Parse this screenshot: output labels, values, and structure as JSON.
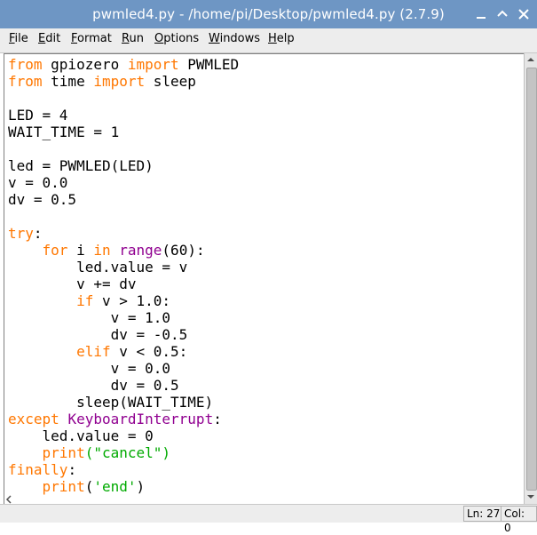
{
  "window": {
    "title": "pwmled4.py - /home/pi/Desktop/pwmled4.py (2.7.9)"
  },
  "menubar": {
    "items": [
      {
        "id": "file",
        "mnemonic": "F",
        "rest": "ile"
      },
      {
        "id": "edit",
        "mnemonic": "E",
        "rest": "dit"
      },
      {
        "id": "format",
        "mnemonic": "F",
        "rest": "ormat"
      },
      {
        "id": "run",
        "mnemonic": "R",
        "rest": "un"
      },
      {
        "id": "options",
        "mnemonic": "O",
        "rest": "ptions"
      },
      {
        "id": "windows",
        "mnemonic": "W",
        "rest": "indows"
      },
      {
        "id": "help",
        "mnemonic": "H",
        "rest": "elp"
      }
    ]
  },
  "editor": {
    "lines": [
      [
        {
          "t": "kw",
          "s": "from"
        },
        {
          "t": "",
          "s": " gpiozero "
        },
        {
          "t": "kw",
          "s": "import"
        },
        {
          "t": "",
          "s": " PWMLED"
        }
      ],
      [
        {
          "t": "kw",
          "s": "from"
        },
        {
          "t": "",
          "s": " time "
        },
        {
          "t": "kw",
          "s": "import"
        },
        {
          "t": "",
          "s": " sleep"
        }
      ],
      [],
      [
        {
          "t": "",
          "s": "LED = 4"
        }
      ],
      [
        {
          "t": "",
          "s": "WAIT_TIME = 1"
        }
      ],
      [],
      [
        {
          "t": "",
          "s": "led = PWMLED(LED)"
        }
      ],
      [
        {
          "t": "",
          "s": "v = 0.0"
        }
      ],
      [
        {
          "t": "",
          "s": "dv = 0.5"
        }
      ],
      [],
      [
        {
          "t": "kw",
          "s": "try"
        },
        {
          "t": "",
          "s": ":"
        }
      ],
      [
        {
          "t": "",
          "s": "    "
        },
        {
          "t": "kw",
          "s": "for"
        },
        {
          "t": "",
          "s": " i "
        },
        {
          "t": "kw",
          "s": "in"
        },
        {
          "t": "",
          "s": " "
        },
        {
          "t": "bi",
          "s": "range"
        },
        {
          "t": "",
          "s": "(60):"
        }
      ],
      [
        {
          "t": "",
          "s": "        led.value = v"
        }
      ],
      [
        {
          "t": "",
          "s": "        v += dv"
        }
      ],
      [
        {
          "t": "",
          "s": "        "
        },
        {
          "t": "kw",
          "s": "if"
        },
        {
          "t": "",
          "s": " v > 1.0:"
        }
      ],
      [
        {
          "t": "",
          "s": "            v = 1.0"
        }
      ],
      [
        {
          "t": "",
          "s": "            dv = -0.5"
        }
      ],
      [
        {
          "t": "",
          "s": "        "
        },
        {
          "t": "kw",
          "s": "elif"
        },
        {
          "t": "",
          "s": " v < 0.5:"
        }
      ],
      [
        {
          "t": "",
          "s": "            v = 0.0"
        }
      ],
      [
        {
          "t": "",
          "s": "            dv = 0.5"
        }
      ],
      [
        {
          "t": "",
          "s": "        sleep(WAIT_TIME)"
        }
      ],
      [
        {
          "t": "kw",
          "s": "except"
        },
        {
          "t": "",
          "s": " "
        },
        {
          "t": "bi",
          "s": "KeyboardInterrupt"
        },
        {
          "t": "",
          "s": ":"
        }
      ],
      [
        {
          "t": "",
          "s": "    led.value = 0"
        }
      ],
      [
        {
          "t": "",
          "s": "    "
        },
        {
          "t": "kw",
          "s": "print"
        },
        {
          "t": "str",
          "s": "(\"cancel\")"
        }
      ],
      [
        {
          "t": "kw",
          "s": "finally"
        },
        {
          "t": "",
          "s": ":"
        }
      ],
      [
        {
          "t": "",
          "s": "    "
        },
        {
          "t": "kw",
          "s": "print"
        },
        {
          "t": "",
          "s": "("
        },
        {
          "t": "str",
          "s": "'end'"
        },
        {
          "t": "",
          "s": ")"
        }
      ]
    ]
  },
  "statusbar": {
    "line": "Ln: 27",
    "col": "Col: 0"
  },
  "colors": {
    "titlebar": "#6e96c4",
    "keyword": "#ff7700",
    "builtin": "#900090",
    "string": "#00aa00"
  },
  "icons": {
    "minimize": "minimize-icon",
    "maximize": "maximize-icon",
    "close": "close-icon"
  }
}
